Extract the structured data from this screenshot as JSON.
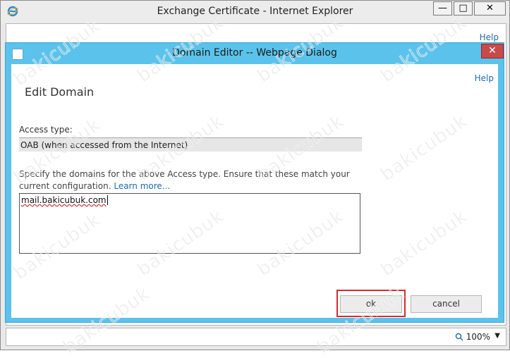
{
  "outer_window": {
    "title": "Exchange Certificate - Internet Explorer",
    "minimize_label": "—",
    "maximize_label": "□",
    "close_label": "✕",
    "help_label": "Help",
    "zoom_label": "100%",
    "zoom_icon": "magnifier-icon",
    "zoom_dropdown_icon": "▼"
  },
  "dialog": {
    "title": "Domain Editor -- Webpage Dialog",
    "close_label": "✕",
    "help_label": "Help",
    "page_title": "Edit Domain",
    "access_type_label": "Access type:",
    "access_type_value": "OAB (when accessed from the Internet)",
    "description_text": "Specify the domains for the above Access type. Ensure that these match your current configuration. ",
    "learn_more_label": "Learn more...",
    "domains_value": "mail.bakicubuk.com",
    "ok_label": "ok",
    "cancel_label": "cancel"
  },
  "watermark": {
    "text": "bakicubuk"
  },
  "colors": {
    "dialog_frame": "#5bc3eb",
    "close_button": "#c74b4b",
    "link": "#1e6bb0",
    "highlight": "#d42c2c"
  }
}
